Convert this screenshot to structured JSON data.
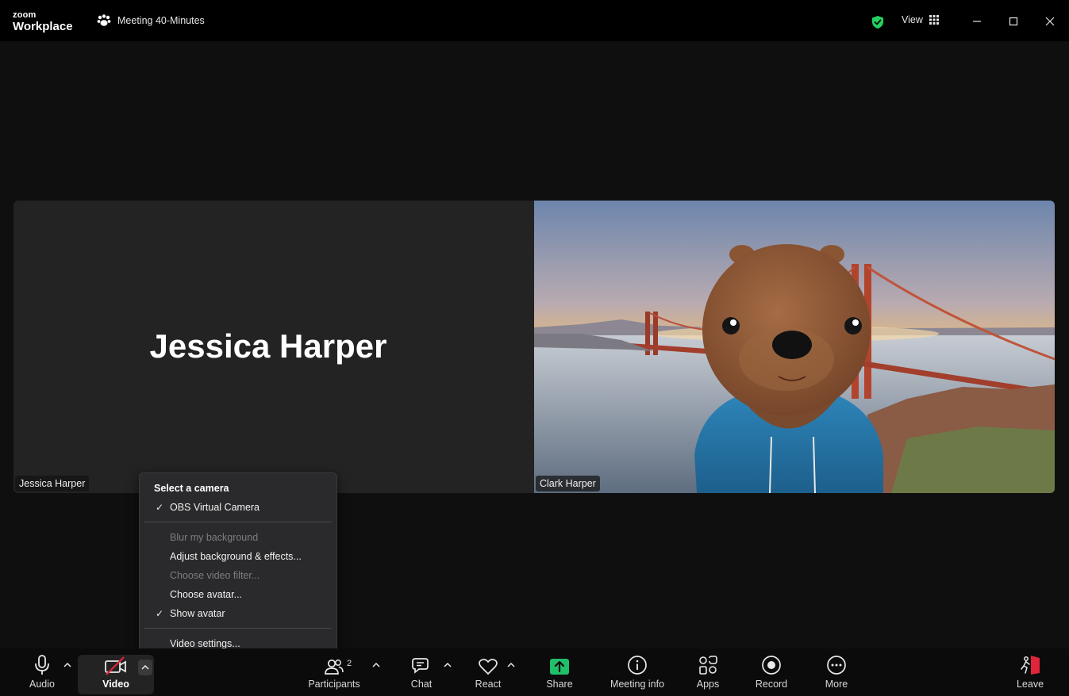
{
  "app": {
    "logo_line1": "zoom",
    "logo_line2": "Workplace",
    "meeting_title": "Meeting 40-Minutes",
    "view_label": "View",
    "security_color": "#23d160"
  },
  "tiles": {
    "left": {
      "display_name": "Jessica Harper",
      "name_tag": "Jessica Harper"
    },
    "right": {
      "name_tag": "Clark Harper"
    }
  },
  "camera_menu": {
    "header": "Select a camera",
    "camera": "OBS Virtual Camera",
    "blur": "Blur my background",
    "adjust": "Adjust background & effects...",
    "filter": "Choose video filter...",
    "avatar": "Choose avatar...",
    "show_avatar": "Show avatar",
    "settings": "Video settings..."
  },
  "toolbar": {
    "audio": "Audio",
    "video": "Video",
    "participants": "Participants",
    "participants_count": "2",
    "chat": "Chat",
    "react": "React",
    "share": "Share",
    "meeting_info": "Meeting info",
    "apps": "Apps",
    "record": "Record",
    "more": "More",
    "leave": "Leave",
    "share_color": "#1fbf6c",
    "leave_color": "#e0243a"
  }
}
